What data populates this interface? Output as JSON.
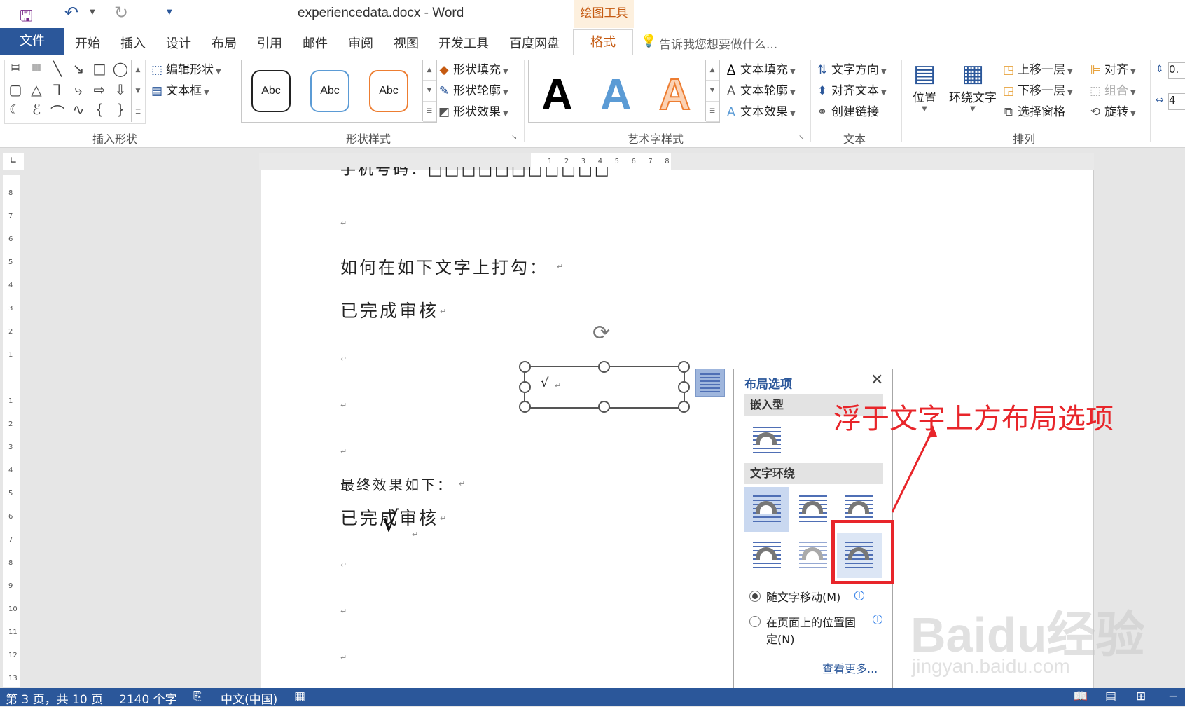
{
  "titlebar": {
    "title": "experiencedata.docx - Word",
    "context_tab": "绘图工具"
  },
  "tabs": {
    "file": "文件",
    "home": "开始",
    "insert": "插入",
    "design": "设计",
    "layout": "布局",
    "references": "引用",
    "mailings": "邮件",
    "review": "审阅",
    "view": "视图",
    "developer": "开发工具",
    "baidu": "百度网盘",
    "format": "格式",
    "tell_me": "告诉我您想要做什么..."
  },
  "ribbon": {
    "insert_shapes": {
      "label": "插入形状",
      "edit_shape": "编辑形状",
      "textbox": "文本框"
    },
    "shape_styles": {
      "label": "形状样式",
      "style_text": "Abc",
      "fill": "形状填充",
      "outline": "形状轮廓",
      "effects": "形状效果"
    },
    "wordart_styles": {
      "label": "艺术字样式",
      "glyph": "A",
      "text_fill": "文本填充",
      "text_outline": "文本轮廓",
      "text_effects": "文本效果"
    },
    "text": {
      "label": "文本",
      "direction": "文字方向",
      "align": "对齐文本",
      "link": "创建链接"
    },
    "arrange": {
      "label": "排列",
      "position": "位置",
      "wrap": "环绕文字",
      "forward": "上移一层",
      "backward": "下移一层",
      "selection_pane": "选择窗格",
      "align": "对齐",
      "group": "组合",
      "rotate": "旋转"
    },
    "size": {
      "height": "0.",
      "width": "4"
    }
  },
  "document": {
    "line_top": "手机号码：□□□□□□□□□□□",
    "question": "如何在如下文字上打勾：",
    "review_text": "已完成审核",
    "textbox_content": "√",
    "final_label": "最终效果如下：",
    "final_text": "已完成审核",
    "check": "√",
    "para_mark": "↵"
  },
  "layout_options": {
    "title": "布局选项",
    "inline_section": "嵌入型",
    "wrap_section": "文字环绕",
    "move_with_text": "随文字移动(M)",
    "fix_position": "在页面上的位置固定(N)",
    "fix_position_line1": "在页面上的位置固",
    "fix_position_line2": "定(N)",
    "more": "查看更多..."
  },
  "annotation": {
    "text": "浮于文字上方布局选项",
    "color": "#e8252a"
  },
  "statusbar": {
    "page": "第 3 页，共 10 页",
    "words": "2140 个字",
    "language": "中文(中国)"
  },
  "watermark": {
    "brand": "Baidu经验",
    "url": "jingyan.baidu.com"
  },
  "colors": {
    "accent": "#2b579a",
    "context": "#c55a11"
  }
}
